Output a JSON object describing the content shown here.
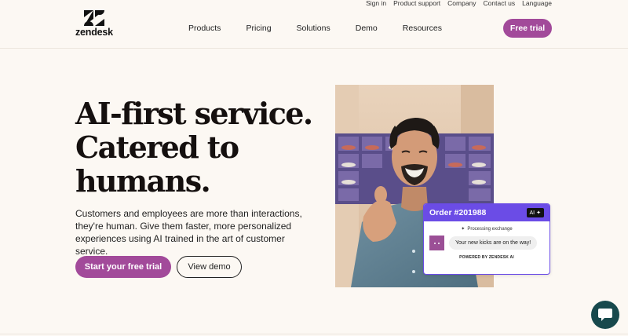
{
  "utility_nav": [
    "Sign in",
    "Product support",
    "Company",
    "Contact us",
    "Language"
  ],
  "logo": {
    "word": "zendesk",
    "icon": "zendesk-z-logo"
  },
  "main_nav": [
    "Products",
    "Pricing",
    "Solutions",
    "Demo",
    "Resources"
  ],
  "header_cta": "Free trial",
  "hero": {
    "title_lines": [
      "AI-first service.",
      "Catered to",
      "humans."
    ],
    "body": "Customers and employees are more than interactions, they're human. Give them faster, more personalized experiences using AI trained in the art of customer service.",
    "primary_cta": "Start your free trial",
    "secondary_cta": "View demo"
  },
  "chat_widget": {
    "order_label": "Order #201988",
    "ai_badge": "AI",
    "status": "Processing exchange",
    "message": "Your new kicks are on the way!",
    "powered_by": "POWERED BY ZENDESK AI"
  },
  "help_button": {
    "icon": "chat-bubble-icon"
  },
  "colors": {
    "brand_purple": "#a24a9a",
    "ai_purple": "#6b4ce6",
    "help_teal": "#17494d",
    "background": "#fcf8f3"
  }
}
